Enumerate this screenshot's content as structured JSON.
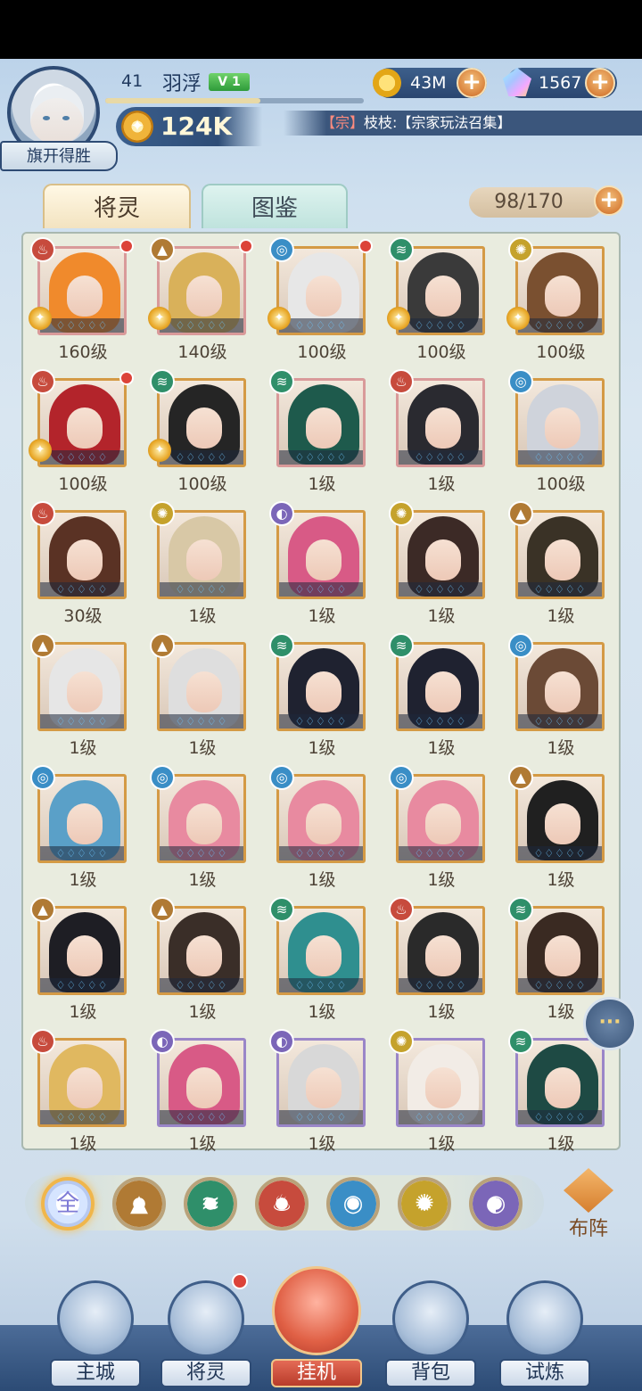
{
  "player": {
    "level": "41",
    "name": "羽浮",
    "vip": "V 1",
    "title": "旗开得胜",
    "power": "124K"
  },
  "resources": {
    "coins": "43M",
    "gems": "1567"
  },
  "chat": {
    "tag": "【宗】",
    "text": "枝枝:【宗家玩法召集】"
  },
  "tabs": {
    "active": "将灵",
    "inactive": "图鉴"
  },
  "capacity": "98/170",
  "element_colors": {
    "fire": "#c74b3d",
    "mountain": "#b07a34",
    "wind": "#2f8f6a",
    "water": "#3a8ec6",
    "light": "#c5a22c",
    "dark": "#7b66b8"
  },
  "heroes": [
    {
      "element": "fire",
      "level": "160级",
      "hair": "#f08a2c",
      "red_dot": true,
      "gold": true,
      "frame": "pinkframe"
    },
    {
      "element": "mountain",
      "level": "140级",
      "hair": "#d9b15a",
      "red_dot": true,
      "gold": true,
      "frame": "pinkframe"
    },
    {
      "element": "water",
      "level": "100级",
      "hair": "#e7e7e7",
      "red_dot": true,
      "gold": true,
      "frame": "gold"
    },
    {
      "element": "wind",
      "level": "100级",
      "hair": "#3a3a3a",
      "red_dot": false,
      "gold": true,
      "frame": "gold"
    },
    {
      "element": "light",
      "level": "100级",
      "hair": "#7a5030",
      "red_dot": false,
      "gold": true,
      "frame": "gold"
    },
    {
      "element": "fire",
      "level": "100级",
      "hair": "#b3242b",
      "red_dot": true,
      "gold": true,
      "frame": "gold"
    },
    {
      "element": "wind",
      "level": "100级",
      "hair": "#252525",
      "red_dot": false,
      "gold": true,
      "frame": "gold"
    },
    {
      "element": "wind",
      "level": "1级",
      "hair": "#1e5a4c",
      "red_dot": false,
      "gold": false,
      "frame": "pinkframe"
    },
    {
      "element": "fire",
      "level": "1级",
      "hair": "#2a2a30",
      "red_dot": false,
      "gold": false,
      "frame": "pinkframe"
    },
    {
      "element": "water",
      "level": "100级",
      "hair": "#cfd3db",
      "red_dot": false,
      "gold": false,
      "frame": "gold"
    },
    {
      "element": "fire",
      "level": "30级",
      "hair": "#5a3224",
      "red_dot": false,
      "gold": false,
      "frame": "gold"
    },
    {
      "element": "light",
      "level": "1级",
      "hair": "#d8c8a6",
      "red_dot": false,
      "gold": false,
      "frame": "gold"
    },
    {
      "element": "dark",
      "level": "1级",
      "hair": "#d85a86",
      "red_dot": false,
      "gold": false,
      "frame": "gold"
    },
    {
      "element": "light",
      "level": "1级",
      "hair": "#3c2a26",
      "red_dot": false,
      "gold": false,
      "frame": "gold"
    },
    {
      "element": "mountain",
      "level": "1级",
      "hair": "#3a3226",
      "red_dot": false,
      "gold": false,
      "frame": "gold"
    },
    {
      "element": "mountain",
      "level": "1级",
      "hair": "#e6e6e6",
      "red_dot": false,
      "gold": false,
      "frame": "gold"
    },
    {
      "element": "mountain",
      "level": "1级",
      "hair": "#dedede",
      "red_dot": false,
      "gold": false,
      "frame": "gold"
    },
    {
      "element": "wind",
      "level": "1级",
      "hair": "#1f2230",
      "red_dot": false,
      "gold": false,
      "frame": "gold"
    },
    {
      "element": "wind",
      "level": "1级",
      "hair": "#1f2230",
      "red_dot": false,
      "gold": false,
      "frame": "gold"
    },
    {
      "element": "water",
      "level": "1级",
      "hair": "#6b4a36",
      "red_dot": false,
      "gold": false,
      "frame": "gold"
    },
    {
      "element": "water",
      "level": "1级",
      "hair": "#5aa0c8",
      "red_dot": false,
      "gold": false,
      "frame": "gold"
    },
    {
      "element": "water",
      "level": "1级",
      "hair": "#e88aa0",
      "red_dot": false,
      "gold": false,
      "frame": "gold"
    },
    {
      "element": "water",
      "level": "1级",
      "hair": "#e88aa0",
      "red_dot": false,
      "gold": false,
      "frame": "gold"
    },
    {
      "element": "water",
      "level": "1级",
      "hair": "#e88aa0",
      "red_dot": false,
      "gold": false,
      "frame": "gold"
    },
    {
      "element": "mountain",
      "level": "1级",
      "hair": "#202020",
      "red_dot": false,
      "gold": false,
      "frame": "gold"
    },
    {
      "element": "mountain",
      "level": "1级",
      "hair": "#1e1e24",
      "red_dot": false,
      "gold": false,
      "frame": "gold"
    },
    {
      "element": "mountain",
      "level": "1级",
      "hair": "#3a2e28",
      "red_dot": false,
      "gold": false,
      "frame": "gold"
    },
    {
      "element": "wind",
      "level": "1级",
      "hair": "#2f8f8f",
      "red_dot": false,
      "gold": false,
      "frame": "gold"
    },
    {
      "element": "fire",
      "level": "1级",
      "hair": "#2a2a2a",
      "red_dot": false,
      "gold": false,
      "frame": "gold"
    },
    {
      "element": "wind",
      "level": "1级",
      "hair": "#3a2a22",
      "red_dot": false,
      "gold": false,
      "frame": "gold"
    },
    {
      "element": "fire",
      "level": "1级",
      "hair": "#e0b860",
      "red_dot": false,
      "gold": false,
      "frame": "gold"
    },
    {
      "element": "dark",
      "level": "1级",
      "hair": "#d85a86",
      "red_dot": false,
      "gold": false,
      "frame": "purple"
    },
    {
      "element": "dark",
      "level": "1级",
      "hair": "#d8d8d8",
      "red_dot": false,
      "gold": false,
      "frame": "purple"
    },
    {
      "element": "light",
      "level": "1级",
      "hair": "#f2ece6",
      "red_dot": false,
      "gold": false,
      "frame": "purple"
    },
    {
      "element": "wind",
      "level": "1级",
      "hair": "#1e4a44",
      "red_dot": false,
      "gold": false,
      "frame": "purple"
    }
  ],
  "filters": [
    {
      "name": "all",
      "label": "全",
      "color": "#e8ecf8"
    },
    {
      "name": "mountain",
      "label": "",
      "color": "#b07a34"
    },
    {
      "name": "wind",
      "label": "",
      "color": "#2f8f6a"
    },
    {
      "name": "fire",
      "label": "",
      "color": "#c74b3d"
    },
    {
      "name": "water",
      "label": "",
      "color": "#3a8ec6"
    },
    {
      "name": "light",
      "label": "",
      "color": "#c5a22c"
    },
    {
      "name": "dark",
      "label": "",
      "color": "#7b66b8"
    }
  ],
  "formation_label": "布阵",
  "nav": [
    {
      "key": "city",
      "label": "主城"
    },
    {
      "key": "heroes",
      "label": "将灵",
      "dot": true
    },
    {
      "key": "idle",
      "label": "挂机"
    },
    {
      "key": "bag",
      "label": "背包"
    },
    {
      "key": "trial",
      "label": "试炼"
    }
  ],
  "chat_button": "···"
}
